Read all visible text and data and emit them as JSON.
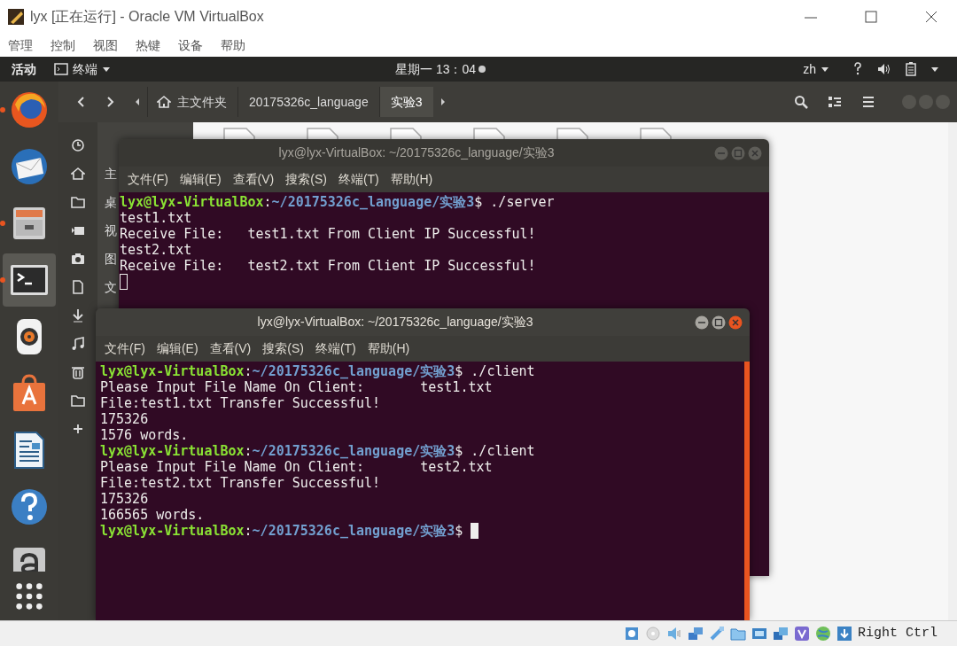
{
  "vbox": {
    "title": "lyx [正在运行] - Oracle VM VirtualBox",
    "menu": [
      "管理",
      "控制",
      "视图",
      "热键",
      "设备",
      "帮助"
    ],
    "status_text": "Right Ctrl"
  },
  "topbar": {
    "activities": "活动",
    "app_menu": "终端",
    "clock": "星期一 13：04",
    "input": "zh"
  },
  "dock": [
    {
      "kind": "firefox",
      "running": true,
      "selected": false
    },
    {
      "kind": "thunderbird",
      "running": false,
      "selected": false
    },
    {
      "kind": "files",
      "running": true,
      "selected": false
    },
    {
      "kind": "terminal",
      "running": true,
      "selected": true
    },
    {
      "kind": "rhythmbox",
      "running": false,
      "selected": false
    },
    {
      "kind": "software",
      "running": false,
      "selected": false
    },
    {
      "kind": "writer",
      "running": false,
      "selected": false
    },
    {
      "kind": "help",
      "running": false,
      "selected": false
    },
    {
      "kind": "amazon",
      "running": false,
      "selected": false
    }
  ],
  "files": {
    "path": [
      {
        "label": "主文件夹",
        "kind": "home",
        "selected": false
      },
      {
        "label": "20175326c_language",
        "kind": "folder",
        "selected": false
      },
      {
        "label": "实验3",
        "kind": "folder",
        "selected": true
      }
    ],
    "places": [
      {
        "kind": "clock"
      },
      {
        "kind": "home",
        "label": "主"
      },
      {
        "kind": "folder",
        "label": "桌"
      },
      {
        "kind": "video",
        "label": "视"
      },
      {
        "kind": "camera",
        "label": "图"
      },
      {
        "kind": "document",
        "label": "文"
      },
      {
        "kind": "download"
      },
      {
        "kind": "music"
      },
      {
        "kind": "trash"
      },
      {
        "kind": "folder"
      },
      {
        "kind": "plus"
      }
    ]
  },
  "terminals": [
    {
      "title": "lyx@lyx-VirtualBox: ~/20175326c_language/实验3",
      "focused": false,
      "menu": [
        "文件(F)",
        "编辑(E)",
        "查看(V)",
        "搜索(S)",
        "终端(T)",
        "帮助(H)"
      ],
      "lines": [
        {
          "kind": "prompt",
          "user": "lyx@lyx-VirtualBox",
          "sep": ":",
          "path": "~/20175326c_language/实验3",
          "command": "$ ./server"
        },
        {
          "kind": "output",
          "text": "test1.txt"
        },
        {
          "kind": "output",
          "text": "Receive File:   test1.txt From Client IP Successful!"
        },
        {
          "kind": "output",
          "text": "test2.txt"
        },
        {
          "kind": "output",
          "text": "Receive File:   test2.txt From Client IP Successful!"
        }
      ]
    },
    {
      "title": "lyx@lyx-VirtualBox: ~/20175326c_language/实验3",
      "focused": true,
      "menu": [
        "文件(F)",
        "编辑(E)",
        "查看(V)",
        "搜索(S)",
        "终端(T)",
        "帮助(H)"
      ],
      "lines": [
        {
          "kind": "prompt",
          "user": "lyx@lyx-VirtualBox",
          "sep": ":",
          "path": "~/20175326c_language/实验3",
          "command": "$ ./client"
        },
        {
          "kind": "output",
          "text": "Please Input File Name On Client:       test1.txt"
        },
        {
          "kind": "output",
          "text": "File:test1.txt Transfer Successful!"
        },
        {
          "kind": "output",
          "text": "175326"
        },
        {
          "kind": "output",
          "text": "1576 words."
        },
        {
          "kind": "prompt",
          "user": "lyx@lyx-VirtualBox",
          "sep": ":",
          "path": "~/20175326c_language/实验3",
          "command": "$ ./client"
        },
        {
          "kind": "output",
          "text": "Please Input File Name On Client:       test2.txt"
        },
        {
          "kind": "output",
          "text": "File:test2.txt Transfer Successful!"
        },
        {
          "kind": "output",
          "text": "175326"
        },
        {
          "kind": "output",
          "text": "166565 words."
        },
        {
          "kind": "prompt",
          "user": "lyx@lyx-VirtualBox",
          "sep": ":",
          "path": "~/20175326c_language/实验3",
          "command": "$ "
        }
      ]
    }
  ]
}
